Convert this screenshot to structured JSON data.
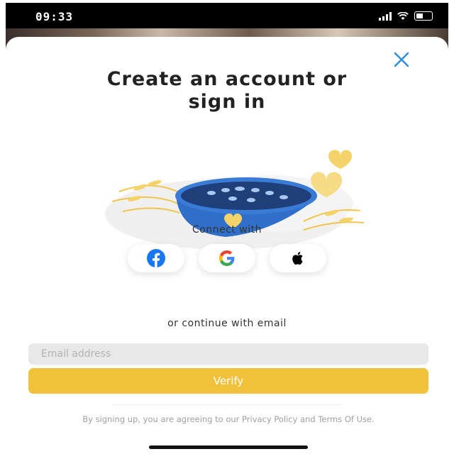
{
  "status_bar": {
    "time": "09:33"
  },
  "sheet": {
    "title_line1": "Create an account or",
    "title_line2": "sign in",
    "connect_label": "Connect with",
    "social": [
      {
        "name": "facebook",
        "icon": "facebook-icon",
        "color": "#1877f2"
      },
      {
        "name": "google",
        "icon": "google-icon"
      },
      {
        "name": "apple",
        "icon": "apple-icon",
        "color": "#000000"
      }
    ],
    "or_email_label": "or continue with email",
    "email": {
      "placeholder": "Email address",
      "value": ""
    },
    "verify_label": "Verify",
    "legal_text": "By signing up, you are agreeing to our Privacy Policy and Terms Of Use."
  },
  "colors": {
    "accent": "#f2c13c",
    "close": "#2f8fdd",
    "bowl": "#3a7bd5"
  }
}
